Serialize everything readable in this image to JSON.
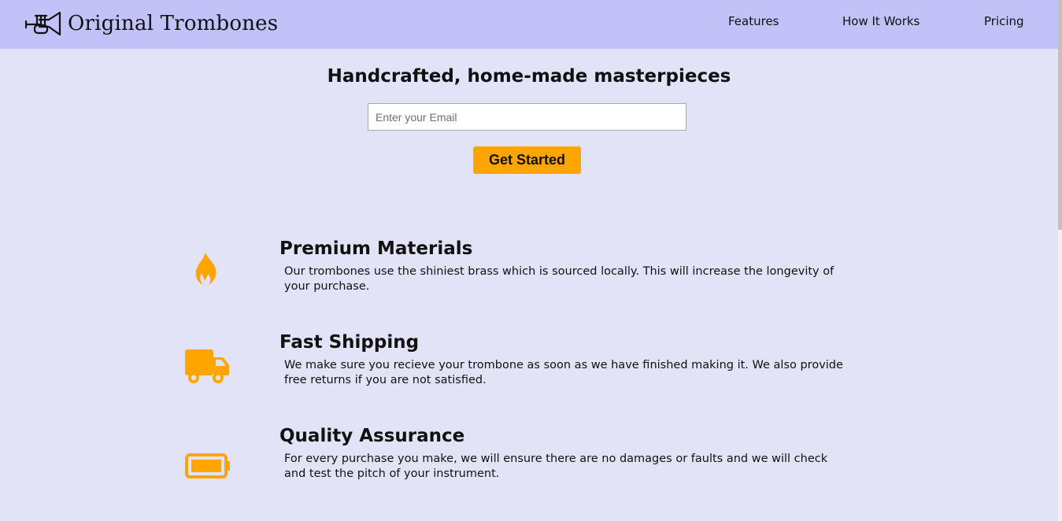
{
  "header": {
    "brand": "Original Trombones",
    "nav": [
      {
        "label": "Features"
      },
      {
        "label": "How It Works"
      },
      {
        "label": "Pricing"
      }
    ]
  },
  "hero": {
    "heading": "Handcrafted, home-made masterpieces",
    "email_placeholder": "Enter your Email",
    "cta_label": "Get Started"
  },
  "features": [
    {
      "icon": "fire-icon",
      "title": "Premium Materials",
      "description": "Our trombones use the shiniest brass which is sourced locally. This will increase the longevity of your purchase."
    },
    {
      "icon": "truck-icon",
      "title": "Fast Shipping",
      "description": "We make sure you recieve your trombone as soon as we have finished making it. We also provide free returns if you are not satisfied."
    },
    {
      "icon": "battery-full-icon",
      "title": "Quality Assurance",
      "description": "For every purchase you make, we will ensure there are no damages or faults and we will check and test the pitch of your instrument."
    }
  ],
  "colors": {
    "header_bg": "#c2c2f8",
    "page_bg": "#e3e3f7",
    "accent": "#ffa500"
  }
}
